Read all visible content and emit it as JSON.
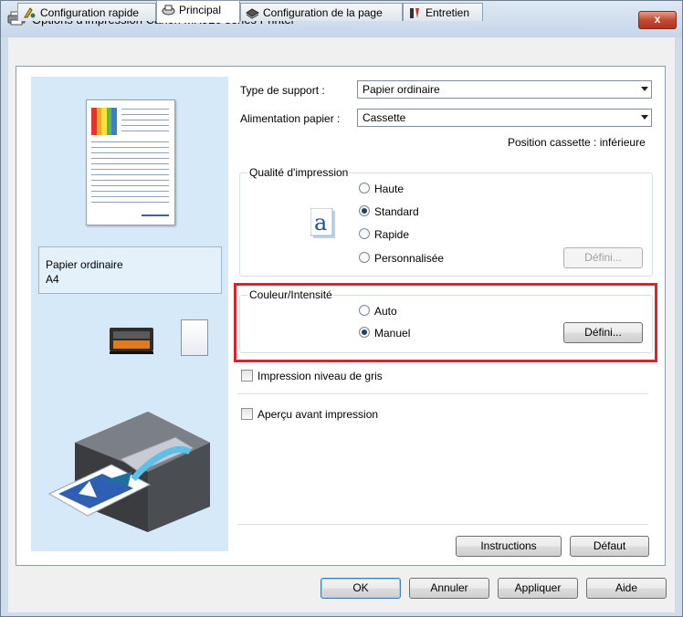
{
  "window": {
    "title": "Options d'impression Canon MX920 series Printer",
    "close_label": "x"
  },
  "tabs": [
    {
      "label": "Configuration rapide",
      "icon": "quick-setup-icon",
      "active": false
    },
    {
      "label": "Principal",
      "icon": "main-icon",
      "active": true
    },
    {
      "label": "Configuration de la page",
      "icon": "page-setup-icon",
      "active": false
    },
    {
      "label": "Entretien",
      "icon": "maintenance-icon",
      "active": false
    }
  ],
  "preview": {
    "media_type": "Papier ordinaire",
    "paper_size": "A4"
  },
  "main": {
    "media_type_label": "Type de support :",
    "media_type_value": "Papier ordinaire",
    "paper_source_label": "Alimentation papier :",
    "paper_source_value": "Cassette",
    "cassette_position": "Position cassette : inférieure",
    "quality": {
      "title": "Qualité d'impression",
      "options": [
        "Haute",
        "Standard",
        "Rapide",
        "Personnalisée"
      ],
      "selected": "Standard",
      "define_label": "Défini..."
    },
    "color": {
      "title": "Couleur/Intensité",
      "options": [
        "Auto",
        "Manuel"
      ],
      "selected": "Manuel",
      "define_label": "Défini..."
    },
    "grayscale_label": "Impression niveau de gris",
    "preview_label": "Aperçu avant impression",
    "instructions_label": "Instructions",
    "defaults_label": "Défaut"
  },
  "footer": {
    "ok": "OK",
    "cancel": "Annuler",
    "apply": "Appliquer",
    "help": "Aide"
  },
  "colors": {
    "highlight": "#e0202a",
    "preview_bg": "#d6e9f8"
  }
}
